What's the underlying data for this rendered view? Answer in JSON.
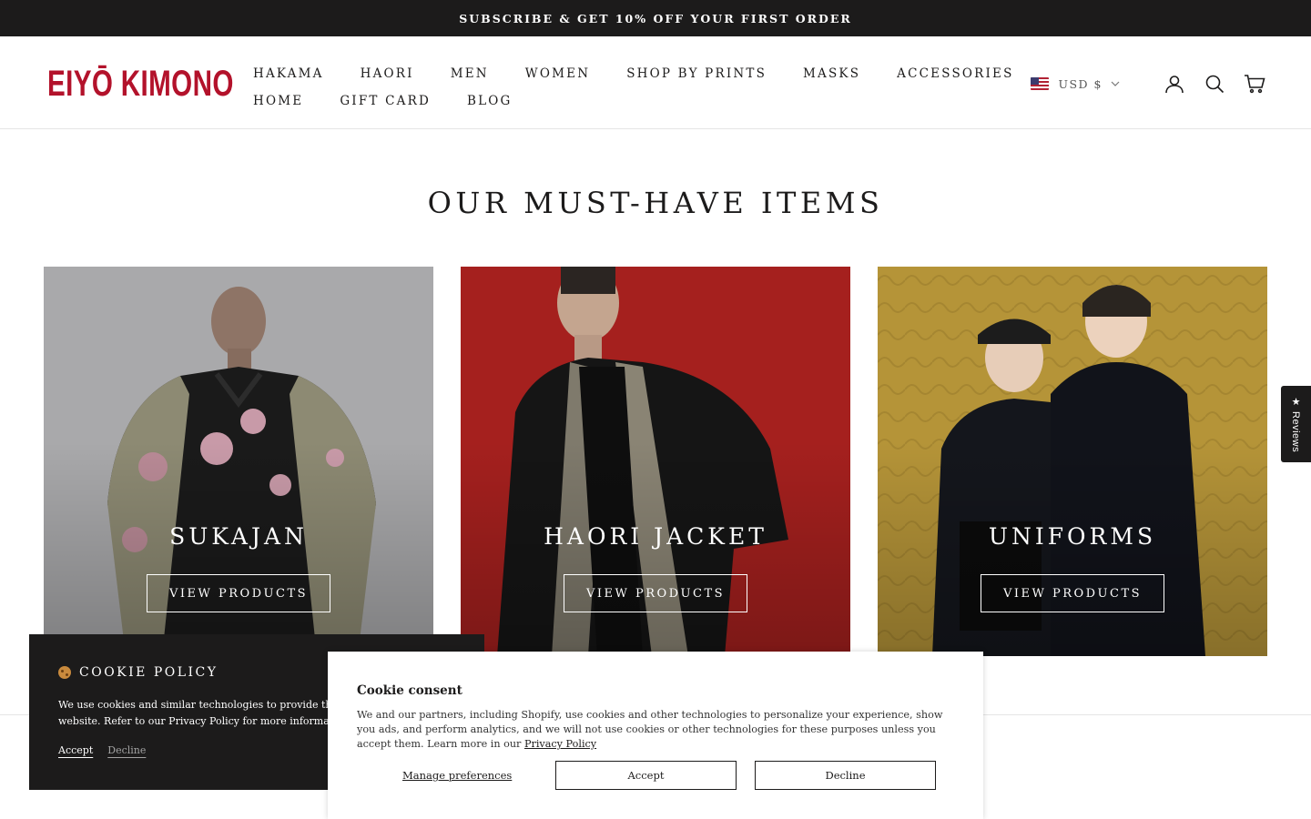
{
  "announcement": "SUBSCRIBE & GET 10% OFF YOUR FIRST ORDER",
  "brand": {
    "logo_text": "EIYŌ KIMONO",
    "color": "#b3122b"
  },
  "nav": {
    "row1": [
      "HAKAMA",
      "HAORI",
      "MEN",
      "WOMEN",
      "SHOP BY PRINTS",
      "MASKS",
      "ACCESSORIES"
    ],
    "row2": [
      "HOME",
      "GIFT CARD",
      "BLOG"
    ]
  },
  "header_right": {
    "currency": "USD $",
    "icons": [
      "account-icon",
      "search-icon",
      "cart-icon"
    ]
  },
  "section": {
    "title": "OUR MUST-HAVE ITEMS",
    "cards": [
      {
        "title": "SUKAJAN",
        "button": "VIEW PRODUCTS"
      },
      {
        "title": "HAORI JACKET",
        "button": "VIEW PRODUCTS"
      },
      {
        "title": "UNIFORMS",
        "button": "VIEW PRODUCTS"
      }
    ]
  },
  "reviews_tab": "★ Reviews",
  "cookie_policy": {
    "title": "COOKIE POLICY",
    "body": "We use cookies and similar technologies to provide the best experience on our website. Refer to our Privacy Policy for more information.",
    "accept": "Accept",
    "decline": "Decline"
  },
  "cookie_consent": {
    "title": "Cookie consent",
    "body": "We and our partners, including Shopify, use cookies and other technologies to personalize your experience, show you ads, and perform analytics, and we will not use cookies or other technologies for these purposes unless you accept them. Learn more in our",
    "privacy_link": "Privacy Policy",
    "manage": "Manage preferences",
    "accept": "Accept",
    "decline": "Decline"
  },
  "colors": {
    "dark": "#1c1b1b",
    "accent": "#b3122b"
  }
}
